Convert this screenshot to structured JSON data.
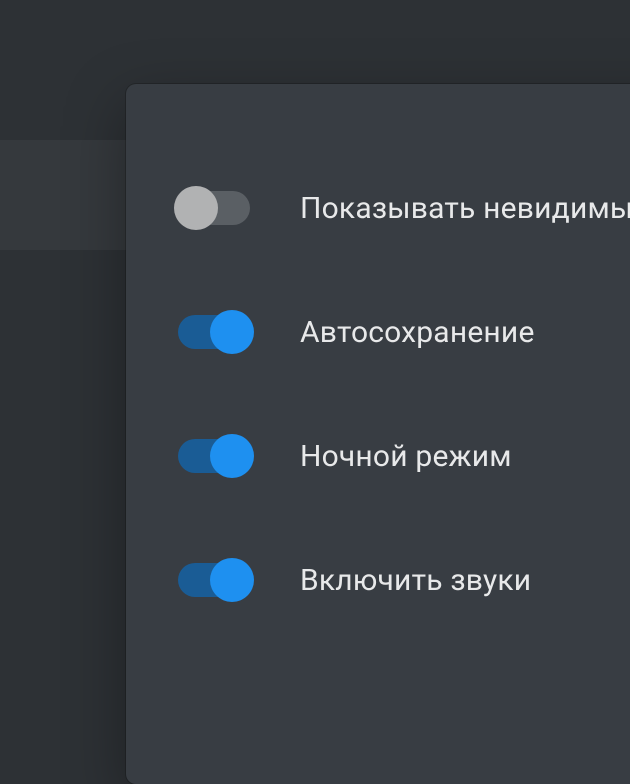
{
  "settings": [
    {
      "label": "Показывать невидимые",
      "on": false
    },
    {
      "label": "Автосохранение",
      "on": true
    },
    {
      "label": "Ночной режим",
      "on": true
    },
    {
      "label": "Включить звуки",
      "on": true
    }
  ]
}
